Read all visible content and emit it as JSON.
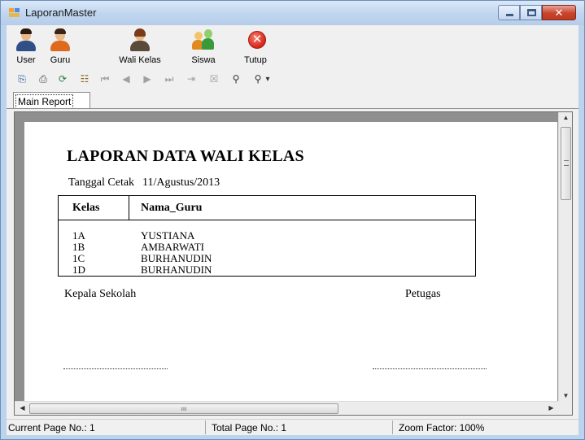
{
  "window": {
    "title": "LaporanMaster",
    "controls": {
      "minimize": "—",
      "maximize": "□",
      "close": "✕"
    }
  },
  "menu": {
    "items": [
      {
        "label": "User",
        "icon": "user-icon"
      },
      {
        "label": "Guru",
        "icon": "teacher-icon"
      },
      {
        "label": "Wali Kelas",
        "icon": "homeroom-teacher-icon"
      },
      {
        "label": "Siswa",
        "icon": "students-icon"
      },
      {
        "label": "Tutup",
        "icon": "close-icon"
      }
    ]
  },
  "report_toolbar": {
    "icons": [
      "export-icon",
      "print-icon",
      "refresh-icon",
      "group-tree-icon",
      "first-page-icon",
      "previous-page-icon",
      "next-page-icon",
      "last-page-icon",
      "goto-page-icon",
      "close-view-icon",
      "search-icon",
      "zoom-icon"
    ],
    "zoom_dropdown": "▾"
  },
  "tab": {
    "label": "Main Report"
  },
  "report": {
    "title": "LAPORAN DATA WALI KELAS",
    "date_label": "Tanggal Cetak",
    "date_value": "11/Agustus/2013",
    "columns": [
      "Kelas",
      "Nama_Guru"
    ],
    "rows": [
      {
        "kelas": "1A",
        "nama_guru": "YUSTIANA"
      },
      {
        "kelas": "1B",
        "nama_guru": "AMBARWATI"
      },
      {
        "kelas": "1C",
        "nama_guru": "BURHANUDIN"
      },
      {
        "kelas": "1D",
        "nama_guru": "BURHANUDIN"
      }
    ],
    "signature_left": "Kepala Sekolah",
    "signature_right": "Petugas"
  },
  "status": {
    "current_page": "Current Page No.: 1",
    "total_page": "Total Page No.: 1",
    "zoom": "Zoom Factor: 100%"
  },
  "colors": {
    "titlebar": "#c1d6ef",
    "close_button": "#c9442b",
    "viewer_background": "#8f8f8f"
  }
}
